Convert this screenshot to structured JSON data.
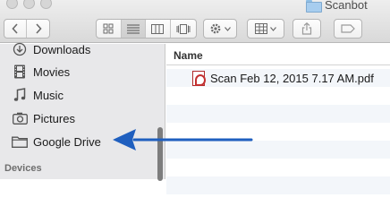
{
  "window": {
    "title": "Scanbot"
  },
  "toolbar": {
    "back_icon": "chevron-left-icon",
    "forward_icon": "chevron-right-icon",
    "view_modes": [
      "icon-view",
      "list-view",
      "column-view",
      "cover-flow-view"
    ],
    "active_view": "list-view",
    "action_icon": "gear-icon",
    "arrange_icon": "grid-arrange-icon",
    "share_icon": "share-icon",
    "tags_icon": "tag-icon"
  },
  "sidebar": {
    "items": [
      {
        "label": "Downloads",
        "icon": "downloads-icon"
      },
      {
        "label": "Movies",
        "icon": "film-icon"
      },
      {
        "label": "Music",
        "icon": "music-note-icon"
      },
      {
        "label": "Pictures",
        "icon": "camera-icon"
      },
      {
        "label": "Google Drive",
        "icon": "folder-icon"
      }
    ],
    "devices_header": "Devices"
  },
  "list": {
    "column_name": "Name",
    "files": [
      {
        "name": "Scan Feb 12, 2015 7.17 AM.pdf",
        "icon": "pdf-file-icon"
      }
    ]
  },
  "annotation": {
    "arrow_color": "#1f5fbf",
    "target": "Google Drive"
  }
}
